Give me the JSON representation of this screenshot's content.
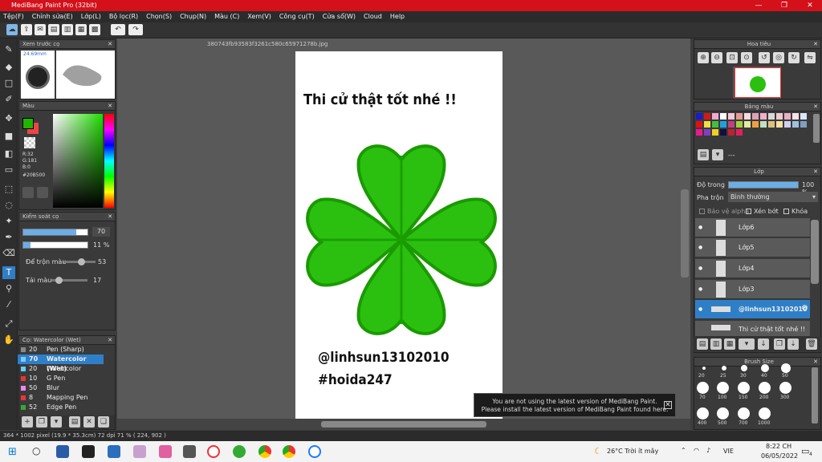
{
  "window": {
    "title": "MediBang Paint Pro (32bit)"
  },
  "menu": [
    "Tệp(F)",
    "Chỉnh sửa(E)",
    "Lớp(L)",
    "Bộ lọc(R)",
    "Chọn(S)",
    "Chụp(N)",
    "Màu (C)",
    "Xem(V)",
    "Công cụ(T)",
    "Cửa sổ(W)",
    "Cloud",
    "Help"
  ],
  "document": {
    "tab_title": "380743fb93583f3261c580c65971278b.jpg",
    "heading": "Thi cử thật tốt nhé !!",
    "handle": "@linhsun13102010",
    "hashtag": "#hoida247"
  },
  "panels": {
    "brush_preview": {
      "title": "Xem trước cọ",
      "size": "24.69mm"
    },
    "color": {
      "title": "Màu",
      "r": "R:32",
      "g": "G:181",
      "b": "B:0",
      "hex": "#20B500"
    },
    "brush_control": {
      "title": "Kiểm soát cọ",
      "size_value": "70",
      "opacity_value": "11 %",
      "blend_label": "Để trộn màu",
      "blend_value": "53",
      "reload_label": "Tải màu",
      "reload_value": "17"
    },
    "brush_list": {
      "title": "Cọ: Watercolor (Wet)",
      "items": [
        {
          "size": "20",
          "name": "Pen (Sharp)"
        },
        {
          "size": "70",
          "name": "Watercolor (Wet)"
        },
        {
          "size": "20",
          "name": "Watercolor"
        },
        {
          "size": "10",
          "name": "G Pen"
        },
        {
          "size": "50",
          "name": "Blur"
        },
        {
          "size": "8",
          "name": "Mapping Pen"
        },
        {
          "size": "52",
          "name": "Edge Pen"
        }
      ]
    },
    "navigator": {
      "title": "Hoa tiêu"
    },
    "palette": {
      "title": "Bảng màu",
      "footer": "---"
    },
    "layers": {
      "title": "Lớp",
      "opacity_label": "Độ trong",
      "opacity_value": "100 %",
      "blend_label": "Pha trộn",
      "blend_value": "Bình thường",
      "protect_alpha": "Bảo vệ alpha",
      "clipping": "Xén bớt",
      "lock": "Khóa",
      "items": [
        "Lớp6",
        "Lớp5",
        "Lớp4",
        "Lớp3",
        "@linhsun13102010",
        "Thi cử thật tốt nhé !!"
      ]
    },
    "brush_size": {
      "title": "Brush Size",
      "sizes": [
        "20",
        "25",
        "30",
        "40",
        "50",
        "70",
        "100",
        "150",
        "200",
        "300",
        "400",
        "500",
        "700",
        "1000"
      ]
    }
  },
  "notification": {
    "line1": "You are not using the latest version of MediBang Paint.",
    "line2": "Please install the latest version of MediBang Paint found here."
  },
  "status": {
    "text": "364 * 1002 pixel   (19.9 * 35.3cm)   72 dpi   71 %   ( 224, 902 )"
  },
  "taskbar": {
    "weather": "26°C  Trời ít mây",
    "lang": "VIE",
    "time": "8:22 CH",
    "date": "06/05/2022",
    "notif_count": "4"
  },
  "colors": {
    "accent": "#d4101a",
    "clover": "#20B500"
  }
}
